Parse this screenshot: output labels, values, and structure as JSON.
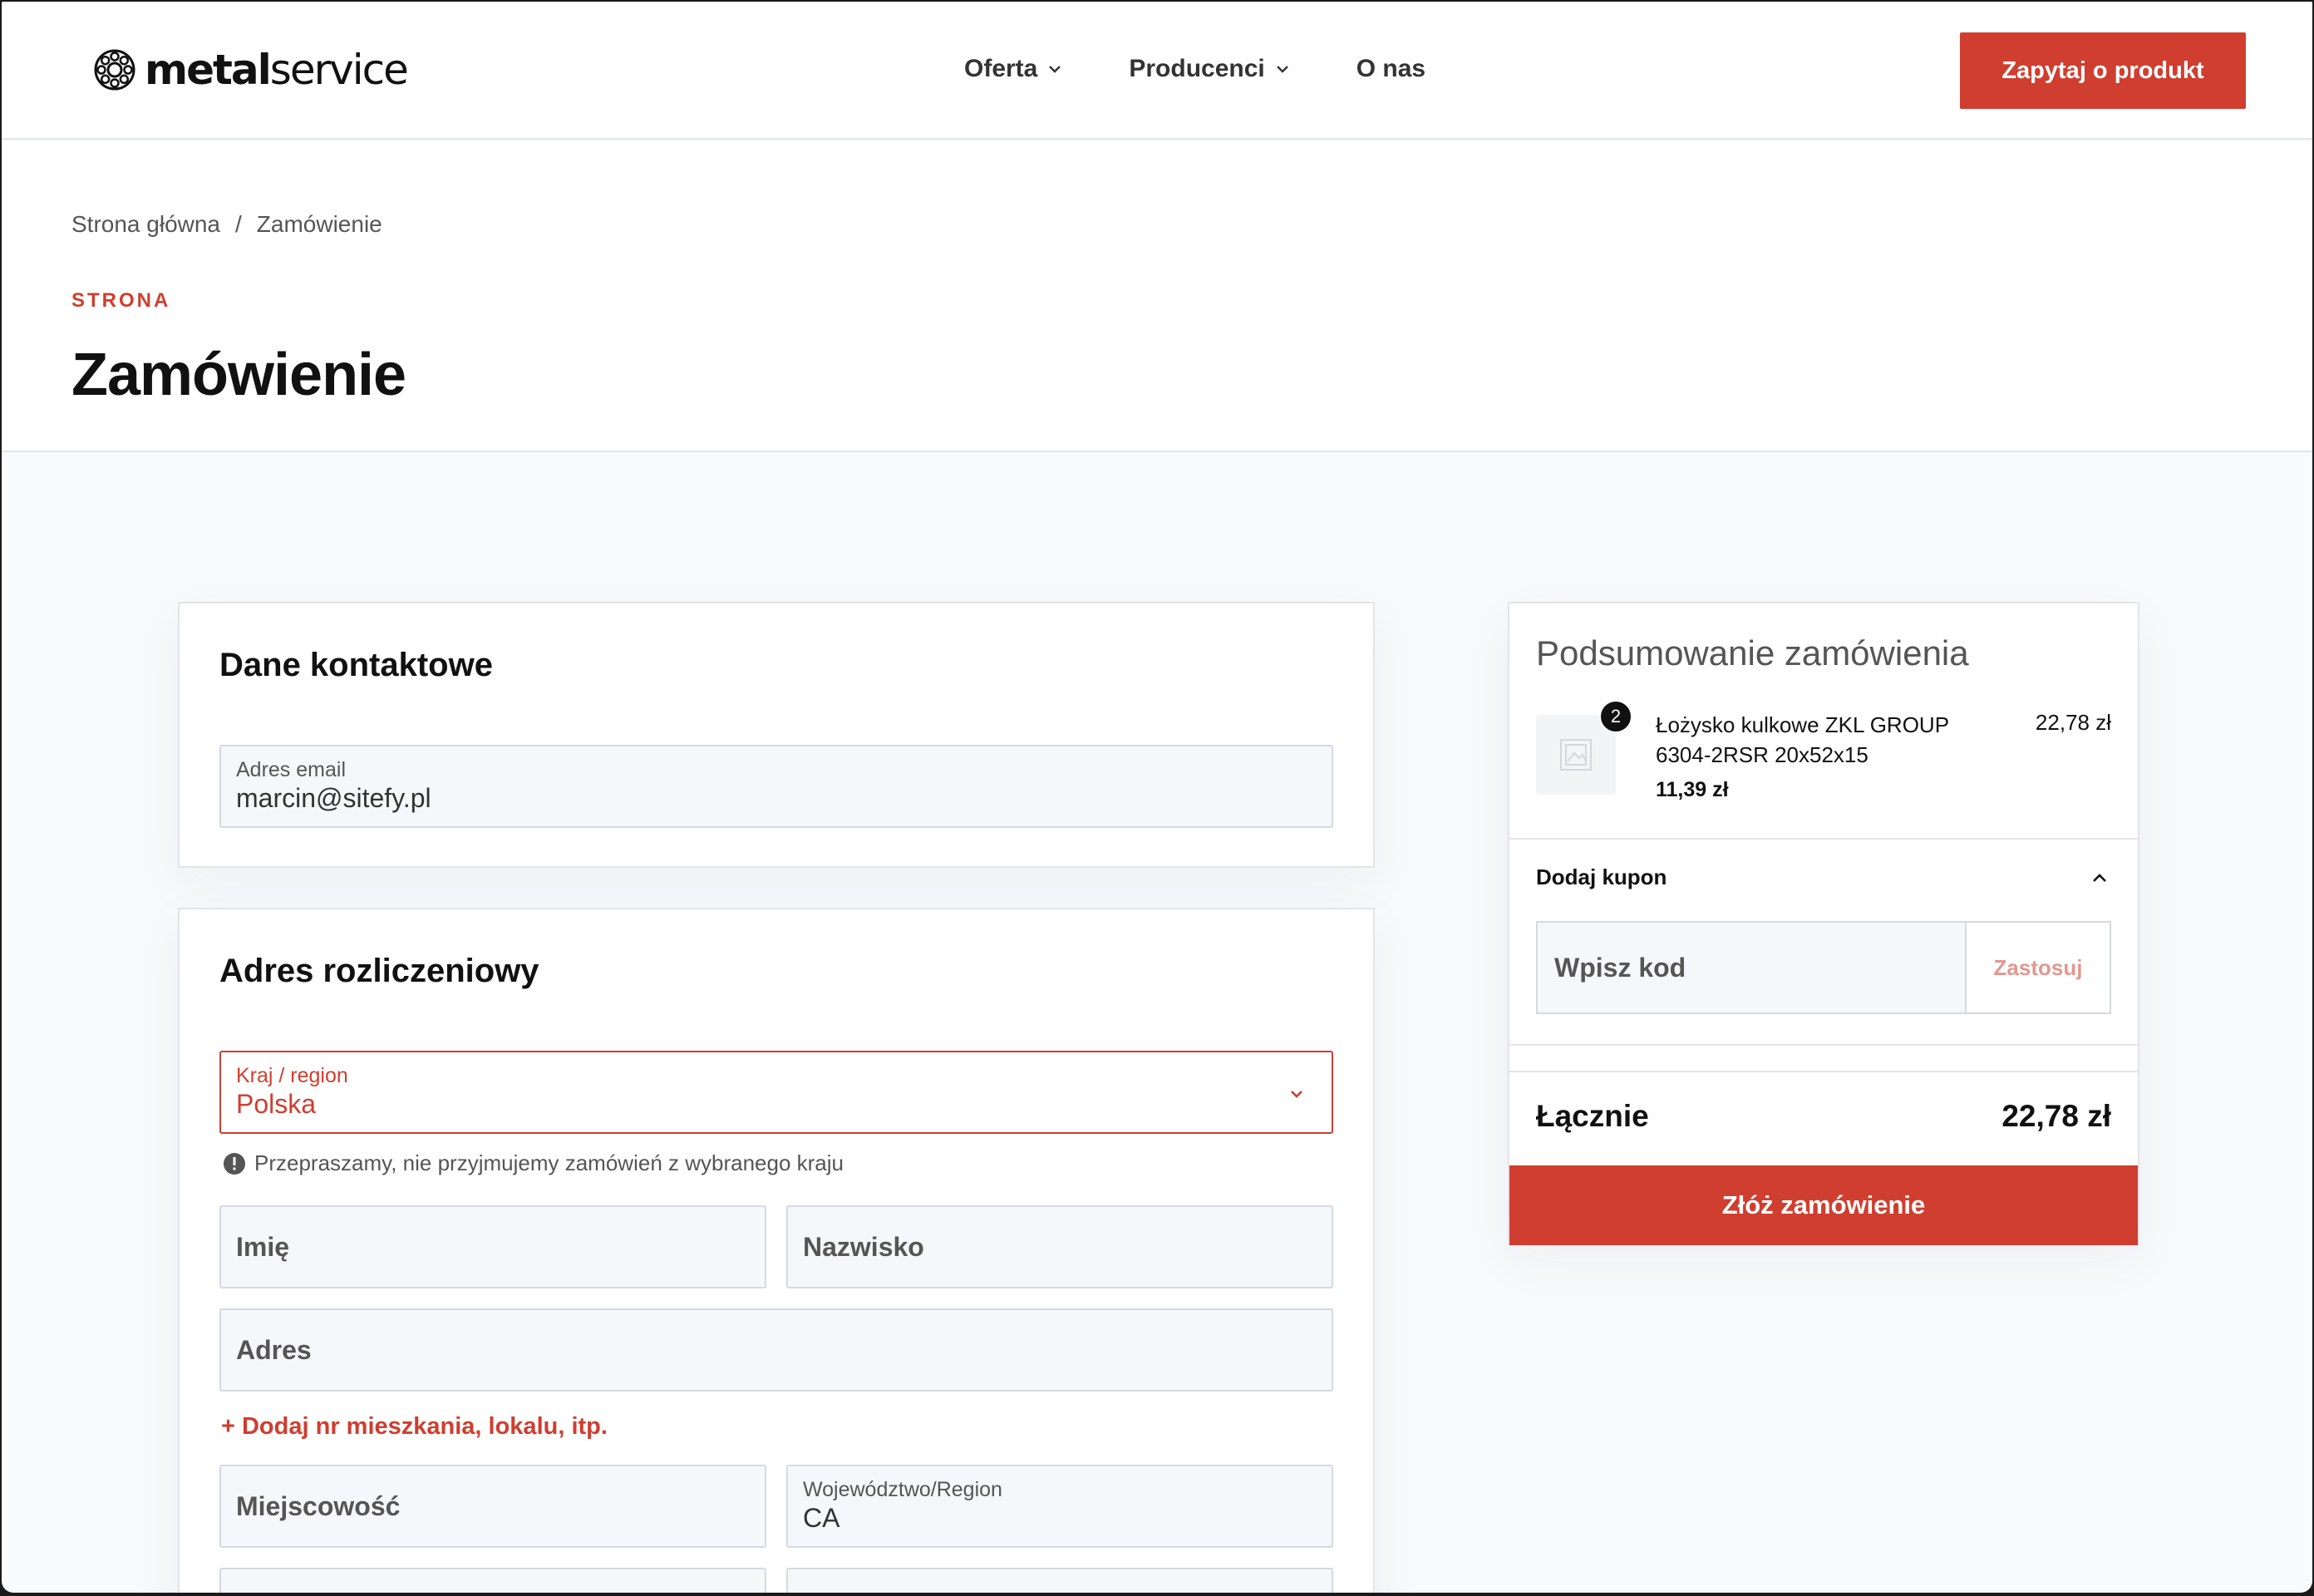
{
  "header": {
    "logo_bold": "metal",
    "logo_light": "service",
    "nav": [
      {
        "label": "Oferta",
        "has_dropdown": true
      },
      {
        "label": "Producenci",
        "has_dropdown": true
      },
      {
        "label": "O nas",
        "has_dropdown": false
      }
    ],
    "cta_label": "Zapytaj o produkt"
  },
  "breadcrumb": {
    "home": "Strona główna",
    "separator": "/",
    "current": "Zamówienie"
  },
  "page": {
    "eyebrow": "STRONA",
    "title": "Zamówienie"
  },
  "contact": {
    "heading": "Dane kontaktowe",
    "email_label": "Adres email",
    "email_value": "marcin@sitefy.pl"
  },
  "billing": {
    "heading": "Adres rozliczeniowy",
    "country_label": "Kraj / region",
    "country_value": "Polska",
    "country_error": "Przepraszamy, nie przyjmujemy zamówień z wybranego kraju",
    "first_name_placeholder": "Imię",
    "last_name_placeholder": "Nazwisko",
    "address_placeholder": "Adres",
    "add_apartment_link": "+ Dodaj nr mieszkania, lokalu, itp.",
    "city_placeholder": "Miejscowość",
    "region_label": "Województwo/Region",
    "region_value": "CA"
  },
  "summary": {
    "heading": "Podsumowanie zamówienia",
    "item": {
      "quantity": "2",
      "name": "Łożysko kulkowe ZKL GROUP 6304-2RSR 20x52x15",
      "unit_price": "11,39 zł",
      "line_total": "22,78 zł"
    },
    "coupon_heading": "Dodaj kupon",
    "coupon_placeholder": "Wpisz kod",
    "coupon_apply": "Zastosuj",
    "total_label": "Łącznie",
    "total_value": "22,78 zł",
    "place_order": "Złóż zamówienie"
  },
  "colors": {
    "accent": "#cf3e2f",
    "background": "#f9fafc",
    "field_bg": "#f5f7fb"
  }
}
